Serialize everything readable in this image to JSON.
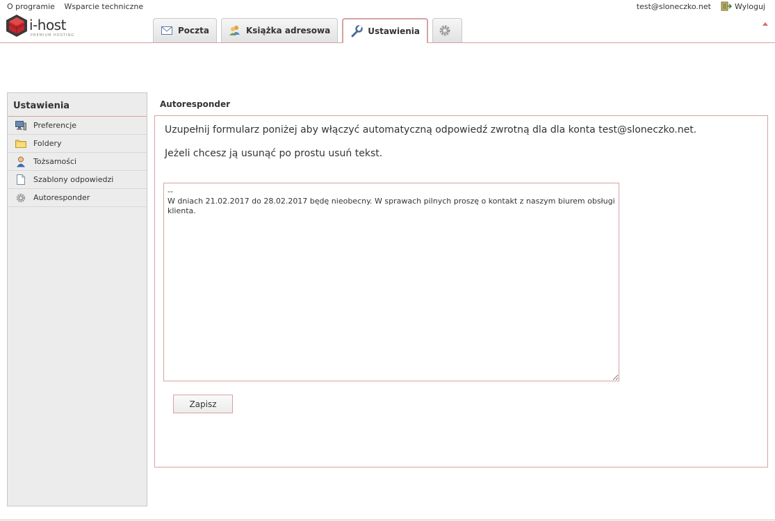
{
  "toplinks": {
    "about": "O programie",
    "support": "Wsparcie techniczne",
    "user_email": "test@sloneczko.net",
    "logout": "Wyloguj"
  },
  "logo": {
    "brand": "i-host",
    "tagline": "PREMIUM HOSTING"
  },
  "tabs": [
    {
      "label": "Poczta",
      "icon": "envelope-icon"
    },
    {
      "label": "Książka adresowa",
      "icon": "contacts-icon"
    },
    {
      "label": "Ustawienia",
      "icon": "wrench-icon",
      "active": true
    },
    {
      "label": "",
      "icon": "gear-icon"
    }
  ],
  "sidebar": {
    "title": "Ustawienia",
    "items": [
      {
        "label": "Preferencje",
        "icon": "monitor-icon"
      },
      {
        "label": "Foldery",
        "icon": "folder-icon"
      },
      {
        "label": "Tożsamości",
        "icon": "person-icon"
      },
      {
        "label": "Szablony odpowiedzi",
        "icon": "document-icon"
      },
      {
        "label": "Autoresponder",
        "icon": "gear-icon"
      }
    ]
  },
  "main": {
    "title": "Autoresponder",
    "intro1": "Uzupełnij formularz poniżej aby włączyć automatyczną odpowiedź zwrotną dla dla konta test@sloneczko.net.",
    "intro2": "Jeżeli chcesz ją usunąć po prostu usuń tekst.",
    "message": "--\nW dniach 21.02.2017 do 28.02.2017 będę nieobecny. W sprawach pilnych proszę o kontakt z naszym biurem obsługi klienta.",
    "save_label": "Zapisz"
  },
  "colors": {
    "accent": "#d8a0a0",
    "logo_red": "#c0272d"
  }
}
